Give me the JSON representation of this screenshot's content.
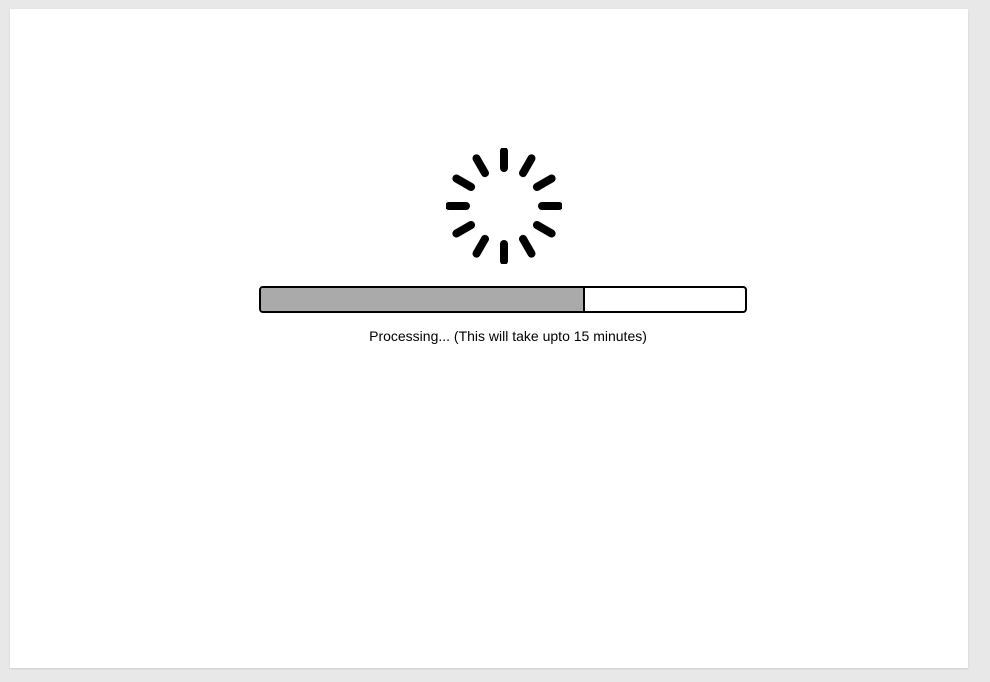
{
  "loading": {
    "spinner_icon": "loading-spinner-icon",
    "progress_fraction": 0.67,
    "status_text": "Processing... (This will take upto 15 minutes)"
  },
  "colors": {
    "background": "#ffffff",
    "progress_fill": "#aaaaaa",
    "progress_border": "#000000",
    "spinner": "#000000"
  }
}
